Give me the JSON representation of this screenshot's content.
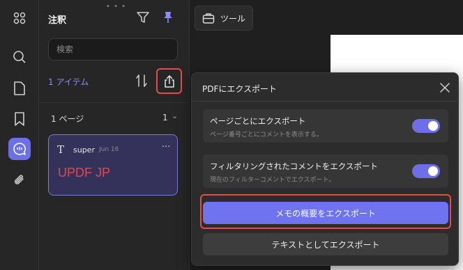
{
  "rail": {
    "items": [
      {
        "name": "apps-icon"
      },
      {
        "name": "search-icon"
      },
      {
        "name": "page-icon"
      },
      {
        "name": "bookmark-icon"
      },
      {
        "name": "comment-icon",
        "active": true
      },
      {
        "name": "attachment-icon"
      }
    ]
  },
  "panel": {
    "title": "注釈",
    "search_placeholder": "検索",
    "item_count": "1 アイテム",
    "page_label": "1 ページ",
    "page_count": "1"
  },
  "annotation": {
    "icon_glyph": "T",
    "author": "super",
    "date": "Jun 16",
    "more": "···",
    "text": "UPDF JP"
  },
  "toolbar": {
    "tools_label": "ツール"
  },
  "dialog": {
    "title": "PDFにエクスポート",
    "options": [
      {
        "title": "ページごとにエクスポート",
        "subtitle": "ページ番号ごとにコメントを表示する。",
        "enabled": true
      },
      {
        "title": "フィルタリングされたコメントをエクスポート",
        "subtitle": "現在のフィルターコメントでエクスポート。",
        "enabled": true
      }
    ],
    "memo_button": "メモの概要をエクスポート",
    "text_button": "テキストとしてエクスポート"
  },
  "colors": {
    "accent": "#6c6fe8",
    "highlight": "#e94b4b",
    "annotation_text": "#e24a4a"
  }
}
